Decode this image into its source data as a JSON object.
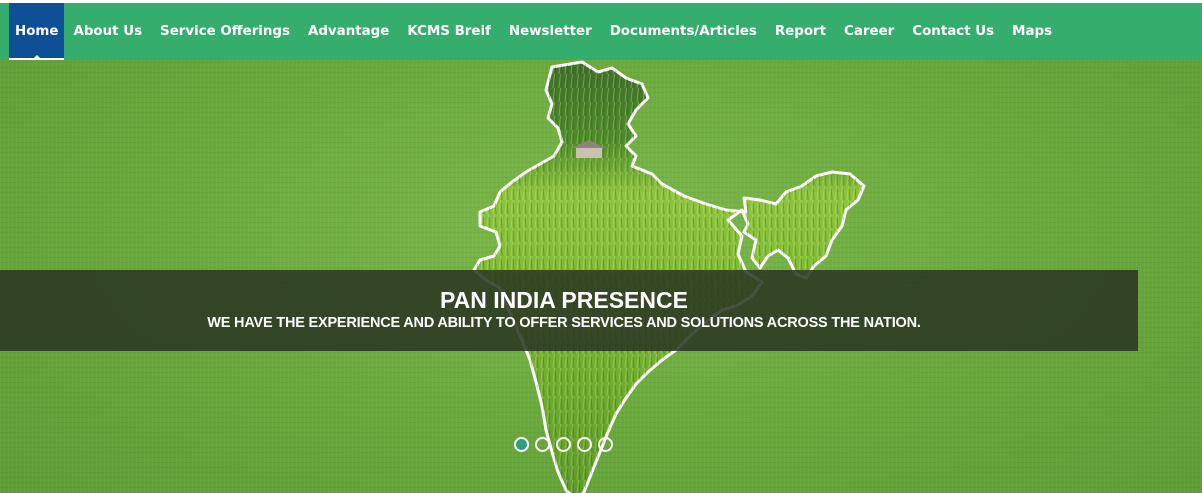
{
  "nav": {
    "items": [
      {
        "label": "Home",
        "active": true
      },
      {
        "label": "About Us",
        "active": false
      },
      {
        "label": "Service Offerings",
        "active": false
      },
      {
        "label": "Advantage",
        "active": false
      },
      {
        "label": "KCMS Breif",
        "active": false
      },
      {
        "label": "Newsletter",
        "active": false
      },
      {
        "label": "Documents/Articles",
        "active": false
      },
      {
        "label": "Report",
        "active": false
      },
      {
        "label": "Career",
        "active": false
      },
      {
        "label": "Contact Us",
        "active": false
      },
      {
        "label": "Maps",
        "active": false
      }
    ]
  },
  "slider": {
    "title": "PAN INDIA PRESENCE",
    "subtitle": "WE HAVE THE EXPERIENCE AND ABILITY TO OFFER SERVICES AND SOLUTIONS ACROSS THE NATION.",
    "image": "india-map-rice-field",
    "slide_count": 5,
    "active_slide": 1
  },
  "colors": {
    "navbar_bg": "#35ae6d",
    "active_nav_bg": "#0f4f96",
    "hero_bg": "#6aa83f",
    "banner_bg": "#2a3422",
    "active_dot": "#2aa37a"
  }
}
